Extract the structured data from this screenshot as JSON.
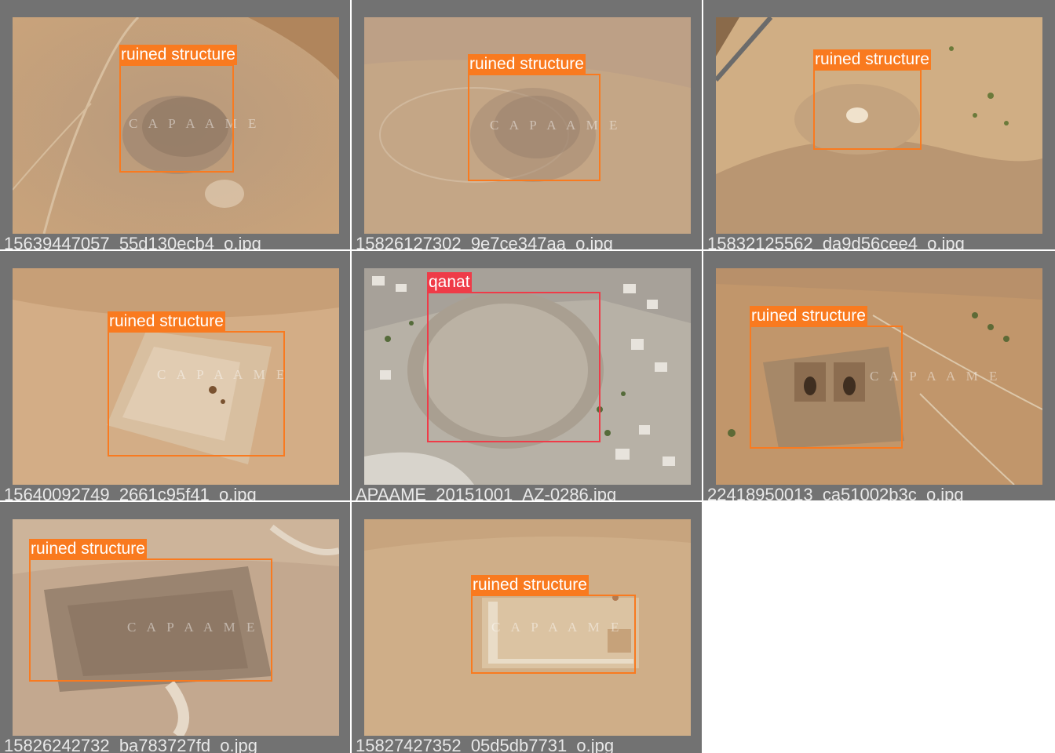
{
  "colors": {
    "tile_background": "#727272",
    "ruined_structure_box": "#f97a1f",
    "qanat_box": "#ef3b48",
    "caption_text": "#e8e8e8"
  },
  "tiles": [
    {
      "filename": "15639447057_55d130ecb4_o.jpg",
      "detections": [
        {
          "label": "ruined structure"
        }
      ],
      "watermark": "C A P A A M E"
    },
    {
      "filename": "15826127302_9e7ce347aa_o.jpg",
      "detections": [
        {
          "label": "ruined structure"
        }
      ],
      "watermark": "C A P A A M E"
    },
    {
      "filename": "15832125562_da9d56cee4_o.jpg",
      "detections": [
        {
          "label": "ruined structure"
        }
      ]
    },
    {
      "filename": "15640092749_2661c95f41_o.jpg",
      "detections": [
        {
          "label": "ruined structure"
        }
      ],
      "watermark": "C A P A A M E"
    },
    {
      "filename": "APAAME_20151001_AZ-0286.jpg",
      "detections": [
        {
          "label": "qanat"
        }
      ]
    },
    {
      "filename": "22418950013_ca51002b3c_o.jpg",
      "detections": [
        {
          "label": "ruined structure"
        }
      ],
      "watermark": "C A P A A M E"
    },
    {
      "filename": "15826242732_ba783727fd_o.jpg",
      "detections": [
        {
          "label": "ruined structure"
        }
      ],
      "watermark": "C A P A A M E"
    },
    {
      "filename": "15827427352_05d5db7731_o.jpg",
      "detections": [
        {
          "label": "ruined structure"
        }
      ],
      "watermark": "C A P A A M E"
    }
  ]
}
